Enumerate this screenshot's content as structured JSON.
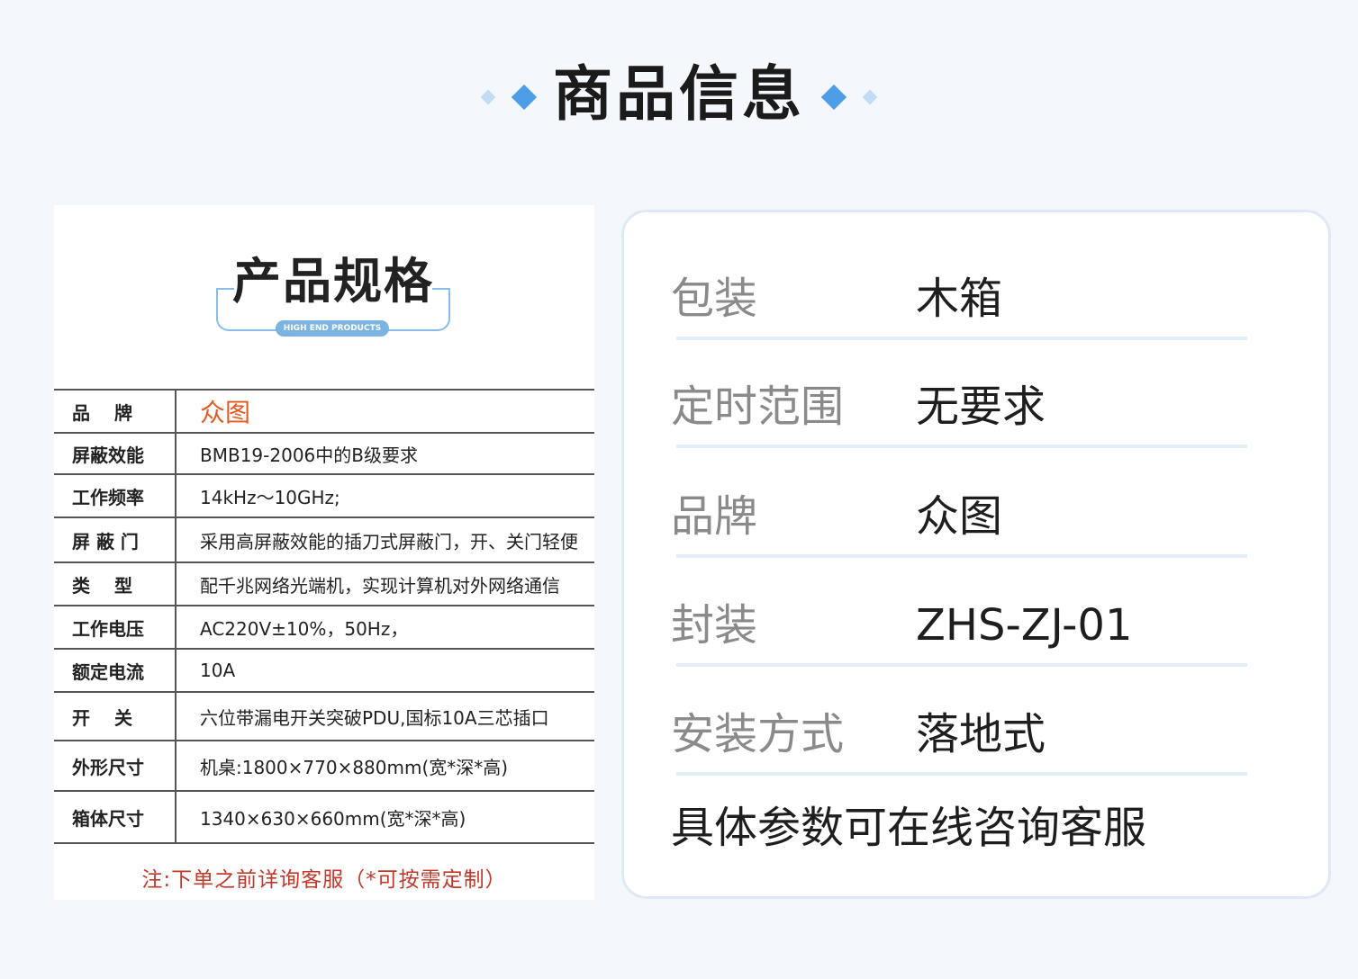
{
  "header": {
    "title": "商品信息"
  },
  "spec": {
    "title": "产品规格",
    "badge": "HIGH END PRODUCTS",
    "rows": [
      {
        "label": "品　 牌",
        "value": "众图"
      },
      {
        "label": "屏蔽效能",
        "value": "BMB19-2006中的B级要求"
      },
      {
        "label": "工作频率",
        "value": "14kHz～10GHz;"
      },
      {
        "label": "屏 蔽 门",
        "value": "采用高屏蔽效能的插刀式屏蔽门，开、关门轻便"
      },
      {
        "label": "类　 型",
        "value": "配千兆网络光端机，实现计算机对外网络通信"
      },
      {
        "label": "工作电压",
        "value": "AC220V±10%，50Hz，"
      },
      {
        "label": "额定电流",
        "value": "10A"
      },
      {
        "label": "开　 关",
        "value": "六位带漏电开关突破PDU,国标10A三芯插口"
      },
      {
        "label": "外形尺寸",
        "value": "机桌:1800×770×880mm(宽*深*高)"
      },
      {
        "label": "箱体尺寸",
        "value": "1340×630×660mm(宽*深*高)"
      }
    ],
    "note": "注:下单之前详询客服（*可按需定制）"
  },
  "info": {
    "rows": [
      {
        "key": "包装",
        "value": "木箱"
      },
      {
        "key": "定时范围",
        "value": "无要求"
      },
      {
        "key": "品牌",
        "value": "众图"
      },
      {
        "key": "封装",
        "value": "ZHS-ZJ-01"
      },
      {
        "key": "安装方式",
        "value": "落地式"
      }
    ],
    "footer": "具体参数可在线咨询客服"
  },
  "colors": {
    "accent_blue": "#4d9ee6",
    "light_blue": "#c2dcf3",
    "brand_orange": "#e35a1f",
    "note_red": "#c0392b"
  }
}
